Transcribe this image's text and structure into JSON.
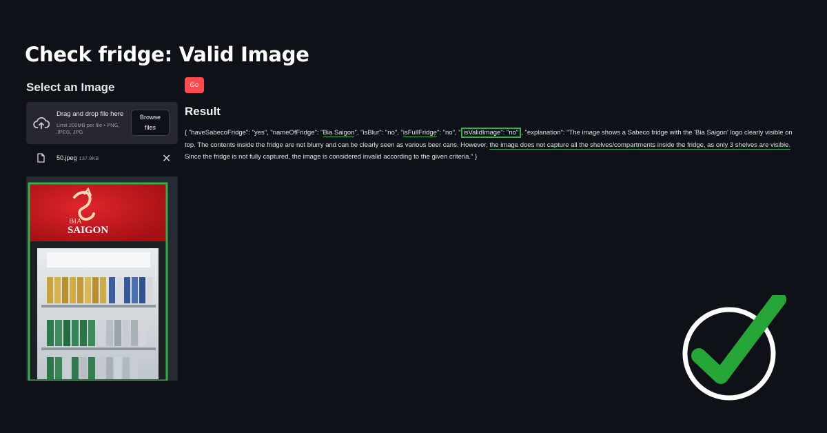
{
  "page_title": "Check fridge: Valid Image",
  "sidebar": {
    "title": "Select an Image",
    "dropzone": {
      "text": "Drag and drop file here",
      "limit": "Limit 200MB per file • PNG, JPEG, JPG",
      "browse_label": "Browse files"
    },
    "file": {
      "name": "50.jpeg",
      "size": "137.9KB"
    },
    "preview": {
      "logo_line1": "BIA",
      "logo_line2": "SAIGON"
    }
  },
  "main": {
    "go_label": "Go",
    "result_title": "Result",
    "result": {
      "s1": "{ \"haveSabecoFridge\": \"yes\", \"nameOfFridge\": \"",
      "u1": "Bia Saigon",
      "s2": "\", \"isBlur\": \"no\", \"",
      "u2": "isFullFridge",
      "s3": "\": \"no\", \"",
      "box": "isValidImage\": \"no\"",
      "s4": ", \"explanation\": \"The image shows a Sabeco fridge with the 'Bia Saigon' logo clearly visible on top. The contents inside the fridge are not blurry and can be clearly seen as various beer cans. However, ",
      "u3": "the image does not capture all the shelves/compartments inside the fridge, as only 3 shelves are visible.",
      "s5": " Since the fridge is not fully captured, the image is considered invalid according to the given criteria.\" }"
    }
  },
  "colors": {
    "background": "#0e1118",
    "panel": "#262730",
    "accent_red": "#ff4b4b",
    "highlight_green": "#2fb24c"
  },
  "icons": {
    "upload": "cloud-upload-icon",
    "file": "file-icon",
    "close": "close-icon",
    "badge": "checkmark-icon"
  }
}
